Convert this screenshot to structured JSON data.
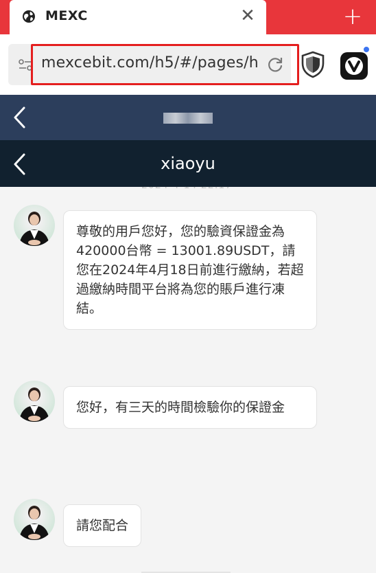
{
  "browser": {
    "tab_title": "MEXC",
    "close_symbol": "✕",
    "new_tab_symbol": "+",
    "url": "mexcebit.com/h5/#/pages/h"
  },
  "chat": {
    "title": "xiaoyu",
    "messages": [
      {
        "sender": "agent",
        "text": "尊敬的用戶您好，您的驗資保證金為420000台幣 = 13001.89USDT，請您在2024年4月18日前進行繳納，若超過繳納時間平台將為您的賬戶進行凍結。"
      },
      {
        "sender": "agent",
        "text": "您好，有三天的時間檢驗你的保證金"
      },
      {
        "sender": "agent",
        "text": "請您配合"
      }
    ]
  },
  "icons": {
    "tab": "globe-icon",
    "site": "site-settings-icon",
    "reload": "reload-icon",
    "shield": "shield-icon",
    "browser": "vivaldi-icon",
    "back": "chevron-left-icon"
  },
  "colors": {
    "tab_strip": "#e8363b",
    "nav_primary": "#2c3e5c",
    "nav_secondary": "#11212f",
    "url_highlight": "#e41e1e"
  }
}
